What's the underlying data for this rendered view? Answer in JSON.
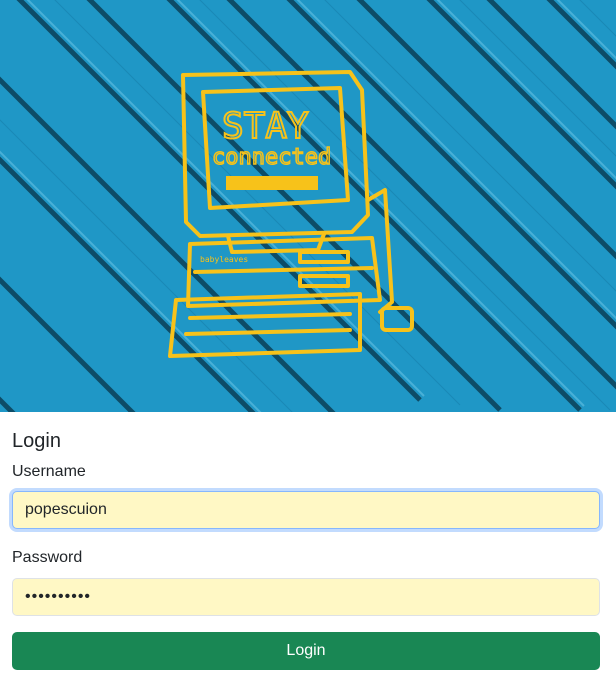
{
  "hero": {
    "image_name": "stay-connected-graffiti-on-blue-fence",
    "graffiti_text_line1": "STAY",
    "graffiti_text_line2": "connected",
    "graffiti_brand": "babyleaves",
    "colors": {
      "wood": "#1f97c6",
      "wood_dark": "#157aa6",
      "paint": "#f7c21a"
    }
  },
  "form": {
    "title": "Login",
    "username": {
      "label": "Username",
      "value": "popescuion"
    },
    "password": {
      "label": "Password",
      "value": "••••••••••"
    },
    "submit_label": "Login"
  },
  "colors": {
    "input_autofill_bg": "#fff8c5",
    "focus_ring": "#86b7fe",
    "button_bg": "#198754",
    "text": "#212529"
  }
}
